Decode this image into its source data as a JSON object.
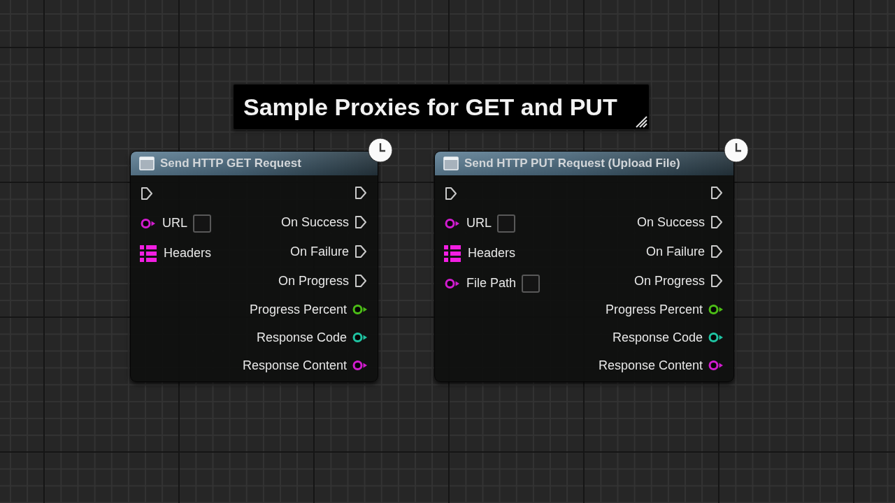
{
  "comment": {
    "text": "Sample Proxies for GET and PUT"
  },
  "nodes": [
    {
      "title": "Send HTTP GET Request",
      "latent": true,
      "inputs": [
        {
          "kind": "exec"
        },
        {
          "kind": "data",
          "label": "URL",
          "color": "#d21ccf",
          "input_box": true
        },
        {
          "kind": "array",
          "label": "Headers",
          "color": "#f21ee2",
          "input_box": false
        }
      ],
      "outputs": [
        {
          "kind": "exec"
        },
        {
          "kind": "exec",
          "label": "On Success"
        },
        {
          "kind": "exec",
          "label": "On Failure"
        },
        {
          "kind": "exec",
          "label": "On Progress"
        },
        {
          "kind": "data",
          "label": "Progress Percent",
          "color": "#4cbd17"
        },
        {
          "kind": "data",
          "label": "Response Code",
          "color": "#1fc4a2"
        },
        {
          "kind": "data",
          "label": "Response Content",
          "color": "#d21ccf"
        }
      ]
    },
    {
      "title": "Send HTTP PUT Request (Upload File)",
      "latent": true,
      "inputs": [
        {
          "kind": "exec"
        },
        {
          "kind": "data",
          "label": "URL",
          "color": "#d21ccf",
          "input_box": true
        },
        {
          "kind": "array",
          "label": "Headers",
          "color": "#f21ee2",
          "input_box": false
        },
        {
          "kind": "data",
          "label": "File Path",
          "color": "#d21ccf",
          "input_box": true
        }
      ],
      "outputs": [
        {
          "kind": "exec"
        },
        {
          "kind": "exec",
          "label": "On Success"
        },
        {
          "kind": "exec",
          "label": "On Failure"
        },
        {
          "kind": "exec",
          "label": "On Progress"
        },
        {
          "kind": "data",
          "label": "Progress Percent",
          "color": "#4cbd17"
        },
        {
          "kind": "data",
          "label": "Response Code",
          "color": "#1fc4a2"
        },
        {
          "kind": "data",
          "label": "Response Content",
          "color": "#d21ccf"
        }
      ]
    }
  ]
}
